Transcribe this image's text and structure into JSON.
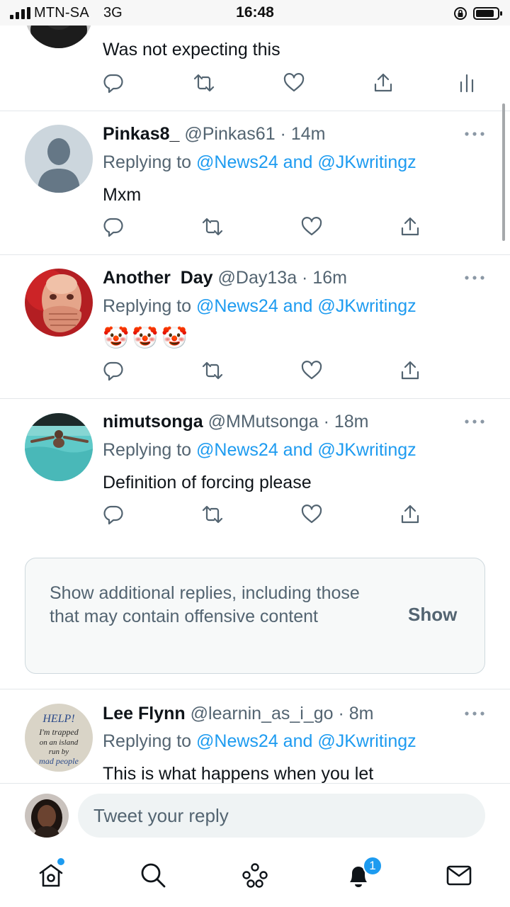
{
  "status_bar": {
    "carrier": "MTN-SA",
    "network": "3G",
    "time": "16:48"
  },
  "tweets": [
    {
      "name": "",
      "handle": "",
      "time": "",
      "replying_prefix": "",
      "replying_to": "",
      "text": "Was not expecting this"
    },
    {
      "name": "Pinkas8_",
      "handle": "@Pinkas61",
      "time": "14m",
      "replying_prefix": "Replying to",
      "replying_to": "@News24 and @JKwritingz",
      "text": "Mxm"
    },
    {
      "name": "Another  Day",
      "handle": "@Day13a",
      "time": "16m",
      "replying_prefix": "Replying to",
      "replying_to": "@News24 and @JKwritingz",
      "text": "🤡🤡🤡"
    },
    {
      "name": "nimutsonga",
      "handle": "@MMutsonga",
      "time": "18m",
      "replying_prefix": "Replying to",
      "replying_to": "@News24 and @JKwritingz",
      "text": "Definition of forcing please"
    },
    {
      "name": "Lee Flynn",
      "handle": "@learnin_as_i_go",
      "time": "8m",
      "replying_prefix": "Replying to",
      "replying_to": "@News24 and @JKwritingz",
      "text": "This is what happens when you let"
    }
  ],
  "separator": " · ",
  "show_more": {
    "text": "Show additional replies, including those that may contain offensive content",
    "button": "Show"
  },
  "avatar_text": {
    "line1": "HELP!",
    "line2": "I'm trapped",
    "line3": "on an island",
    "line4": "run by",
    "line5": "mad people"
  },
  "reply_box": {
    "placeholder": "Tweet your reply"
  },
  "tab_bar": {
    "notification_count": "1"
  },
  "colors": {
    "accent": "#1d9bf0",
    "secondary_text": "#536471",
    "primary_text": "#0f1419"
  },
  "icons": [
    "reply-icon",
    "retweet-icon",
    "like-icon",
    "share-icon",
    "analytics-icon",
    "more-icon",
    "home-icon",
    "search-icon",
    "spaces-icon",
    "notifications-icon",
    "messages-icon"
  ]
}
